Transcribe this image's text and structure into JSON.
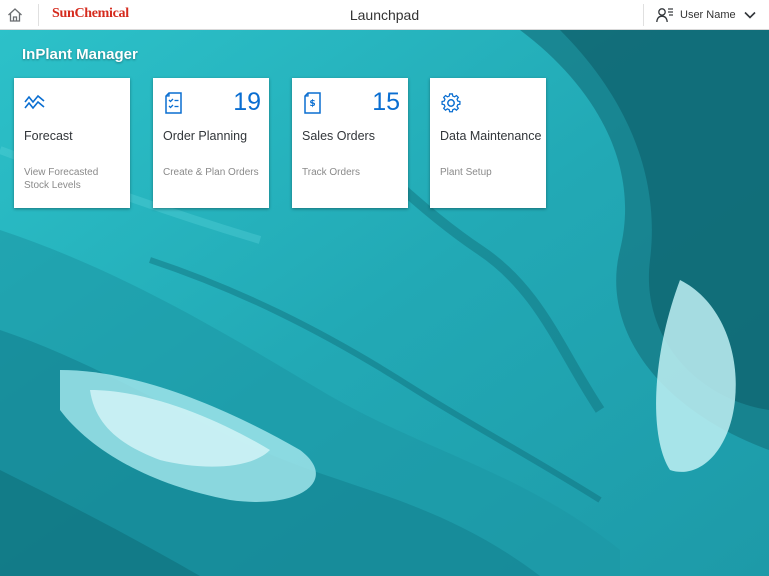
{
  "header": {
    "title": "Launchpad",
    "brand": "SunChemical",
    "user_name": "User Name",
    "home_icon": "home-icon",
    "user_icon": "user-settings-icon",
    "dropdown_icon": "chevron-down-icon"
  },
  "group": {
    "title": "InPlant Manager"
  },
  "tiles": [
    {
      "title": "Forecast",
      "subtitle": "View Forecasted Stock Levels",
      "count": "",
      "icon": "line-chart-icon"
    },
    {
      "title": "Order Planning",
      "subtitle": "Create & Plan Orders",
      "count": "19",
      "icon": "checklist-document-icon"
    },
    {
      "title": "Sales Orders",
      "subtitle": "Track Orders",
      "count": "15",
      "icon": "sales-document-icon"
    },
    {
      "title": "Data Maintenance",
      "subtitle": "Plant Setup",
      "count": "",
      "icon": "gear-icon"
    }
  ],
  "colors": {
    "accent": "#0a6ed1",
    "brand": "#d52b1e",
    "background": "#27b9c3"
  }
}
